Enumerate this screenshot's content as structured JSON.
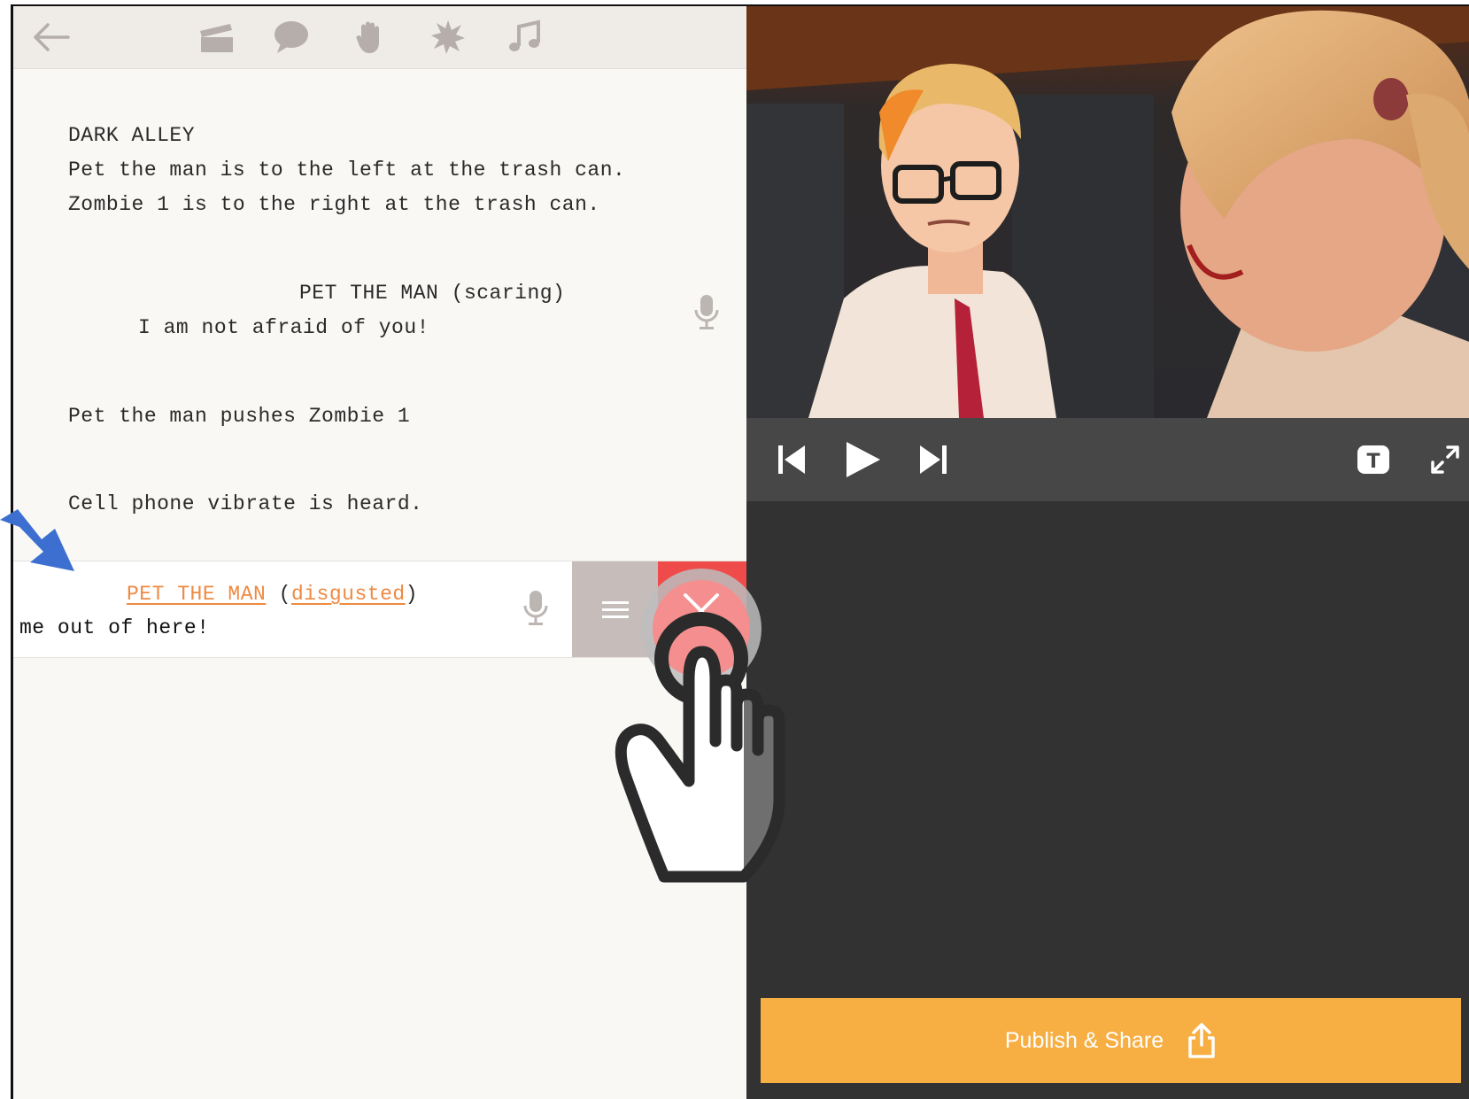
{
  "toolbar": {
    "icons": [
      "back-arrow-icon",
      "clapperboard-icon",
      "speech-bubble-icon",
      "hand-icon",
      "star-burst-icon",
      "music-note-icon"
    ]
  },
  "script": {
    "scene_heading": "DARK ALLEY",
    "action_1": "Pet the man is to the left at the trash can.",
    "action_2": "Zombie 1 is to the right at the trash can.",
    "dialogue_1": {
      "character": "PET THE MAN",
      "parenthetical": "(scaring)",
      "line": "I am not afraid of you!"
    },
    "action_3": "Pet the man pushes Zombie 1",
    "action_4": "Cell phone vibrate is heard.",
    "dialogue_2": {
      "character": "PET THE MAN",
      "open_paren": "(",
      "parenthetical": "disgusted",
      "close_paren": ")",
      "line": "me out of here!"
    }
  },
  "swipe_actions": {
    "reorder_icon": "hamburger-icon",
    "delete_icon": "close-icon"
  },
  "player": {
    "controls": [
      "skip-back-icon",
      "play-icon",
      "skip-forward-icon",
      "text-toggle-icon",
      "fullscreen-icon"
    ],
    "text_toggle_label": "T"
  },
  "publish": {
    "label": "Publish & Share",
    "icon": "share-icon"
  },
  "colors": {
    "accent_orange": "#f7ae42",
    "link_orange": "#ee8a43",
    "delete_red": "#ef4b4b",
    "reorder_gray": "#c6bdbb",
    "dark_panel": "#323232",
    "controls_bar": "#474747",
    "editor_bg": "#f9f8f5"
  }
}
